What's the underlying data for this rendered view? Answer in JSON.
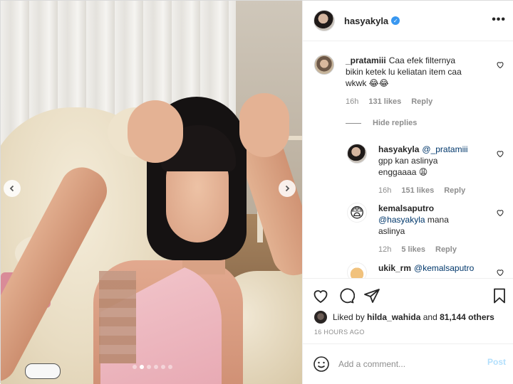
{
  "post": {
    "author": "hasyakyla",
    "verified": true,
    "carousel": {
      "slide_count": 6,
      "active_index": 1
    }
  },
  "comments": [
    {
      "user": "_pratamiii",
      "text_lines": [
        "Caa efek filternya",
        "bikin ketek lu keliatan item caa",
        "wkwk 😂😂"
      ],
      "time": "16h",
      "likes": "131 likes",
      "reply": "Reply"
    }
  ],
  "hide_replies": "Hide replies",
  "replies": [
    {
      "user": "hasyakyla",
      "mention": "@_pratamiii",
      "text_lines": [
        "gpp kan aslinya",
        "enggaaaa 😩"
      ],
      "time": "16h",
      "likes": "151 likes",
      "reply": "Reply"
    },
    {
      "user": "kemalsaputro",
      "mention": "@hasyakyla",
      "text_lines": [
        "mana",
        "aslinya"
      ],
      "time": "12h",
      "likes": "5 likes",
      "reply": "Reply",
      "avatar_emoji": "😨"
    },
    {
      "user": "ukik_rm",
      "mention": "@kemalsaputro"
    }
  ],
  "likes": {
    "prefix": "Liked by",
    "user": "hilda_wahida",
    "connector": "and",
    "others": "81,144 others"
  },
  "timeago": "16 HOURS AGO",
  "add_comment": {
    "placeholder": "Add a comment...",
    "post_label": "Post"
  },
  "icons": {
    "like": "heart-icon",
    "comment": "comment-icon",
    "share": "paper-plane-icon",
    "save": "bookmark-icon",
    "emoji": "smiley-icon",
    "more": "more-dots-icon",
    "prev": "chevron-left-icon",
    "next": "chevron-right-icon"
  },
  "colors": {
    "link": "#00376b",
    "meta": "#8e8e8e",
    "post_button": "#b2dffc",
    "verified": "#3897f0"
  }
}
